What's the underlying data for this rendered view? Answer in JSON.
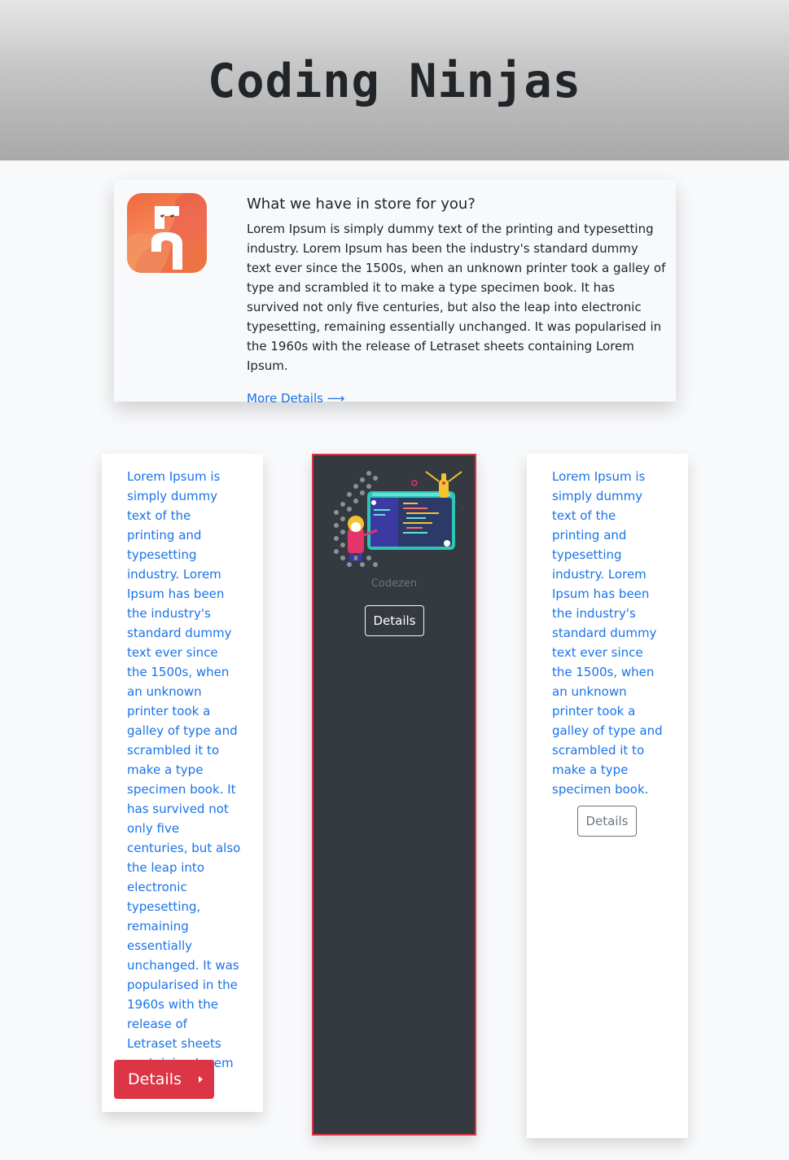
{
  "header": {
    "title": "Coding Ninjas"
  },
  "info_card": {
    "logo_icon": "coding-ninjas-logo",
    "title": "What we have in store for you?",
    "text": "Lorem Ipsum is simply dummy text of the printing and typesetting industry. Lorem Ipsum has been the industry's standard dummy text ever since the 1500s, when an unknown printer took a galley of type and scrambled it to make a type specimen book. It has survived not only five centuries, but also the leap into electronic typesetting, remaining essentially unchanged. It was popularised in the 1960s with the release of Letraset sheets containing Lorem Ipsum.",
    "link_label": "More Details",
    "link_icon": "arrow-right-icon"
  },
  "cards": {
    "left": {
      "text": "Lorem Ipsum is simply dummy text of the printing and typesetting industry. Lorem Ipsum has been the industry's standard dummy text ever since the 1500s, when an unknown printer took a galley of type and scrambled it to make a type specimen book. It has survived not only five centuries, but also the leap into electronic typesetting, remaining essentially unchanged. It was popularised in the 1960s with the release of Letraset sheets containing Lorem Ipsum.",
      "button_label": "Details",
      "button_color": "#dc3545",
      "button_icon": "caret-right-icon"
    },
    "middle": {
      "image": "codezen-illustration",
      "caption": "Codezen",
      "button_label": "Details",
      "background": "#343a40",
      "border_color": "#dc3545"
    },
    "right": {
      "text": "Lorem Ipsum is simply dummy text of the printing and typesetting industry. Lorem Ipsum has been the industry's standard dummy text ever since the 1500s, when an unknown printer took a galley of type and scrambled it to make a type specimen book.",
      "button_label": "Details"
    }
  },
  "colors": {
    "link_blue": "#1a73e8",
    "danger": "#dc3545",
    "dark": "#343a40"
  }
}
